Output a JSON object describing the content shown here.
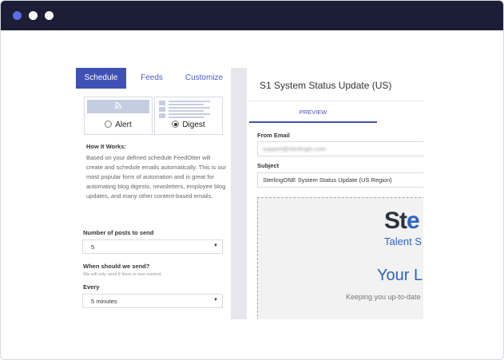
{
  "tabs": [
    "Schedule",
    "Feeds",
    "Customize"
  ],
  "options": {
    "alert_label": "Alert",
    "digest_label": "Digest"
  },
  "how_it_works": {
    "title": "How It Works:",
    "text": "Based on your defined schedule FeedOtter will create and schedule emails automatically. This is our most popular form of automation and is great for automating blog digests, newsletters, employee blog updates, and many other content-based emails."
  },
  "posts": {
    "label": "Number of posts to send",
    "value": "5"
  },
  "when": {
    "label": "When should we send?",
    "note": "We will only send if there is new content."
  },
  "every": {
    "label": "Every",
    "value": "5 minutes"
  },
  "email": {
    "title": "S1 System Status Update (US)",
    "preview_tab": "PREVIEW",
    "from_label": "From Email",
    "from_value": "support@sterlingts.com",
    "subject_label": "Subject",
    "subject_value": "SterlingONE System Status Update (US Region)"
  },
  "preview_content": {
    "logo_prefix": "St",
    "logo_suffix": "e",
    "logo_sub": "Talent S",
    "headline": "Your L",
    "tagline": "Keeping you up-to-date"
  },
  "colors": {
    "accent": "#3f51b5",
    "titlebar": "#1c1d36",
    "logo_dark": "#2b3240",
    "logo_blue": "#2a63c4"
  },
  "icons": [
    "rss-icon",
    "chevron-down-icon"
  ]
}
